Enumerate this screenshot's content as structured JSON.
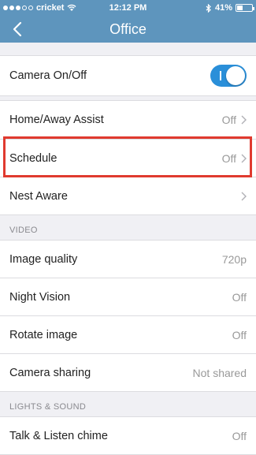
{
  "status": {
    "carrier": "cricket",
    "time": "12:12 PM",
    "battery": "41%",
    "battery_fraction": 0.41
  },
  "nav": {
    "title": "Office",
    "back_icon": "chevron-left-icon"
  },
  "settings": [
    {
      "label": "Camera On/Off",
      "control": "toggle",
      "on": true
    },
    {
      "label": "Home/Away Assist",
      "value": "Off",
      "chevron": true
    },
    {
      "label": "Schedule",
      "value": "Off",
      "chevron": true
    },
    {
      "label": "Nest Aware",
      "value": "",
      "chevron": true
    }
  ],
  "video": {
    "header": "VIDEO",
    "rows": [
      {
        "label": "Image quality",
        "value": "720p"
      },
      {
        "label": "Night Vision",
        "value": "Off"
      },
      {
        "label": "Rotate image",
        "value": "Off"
      },
      {
        "label": "Camera sharing",
        "value": "Not shared"
      }
    ]
  },
  "sound": {
    "header": "LIGHTS & SOUND",
    "rows": [
      {
        "label": "Talk & Listen chime",
        "value": "Off"
      }
    ]
  },
  "colors": {
    "nav": "#5e95bd",
    "toggle_on": "#2a8fd9",
    "highlight": "#e03a2f"
  }
}
